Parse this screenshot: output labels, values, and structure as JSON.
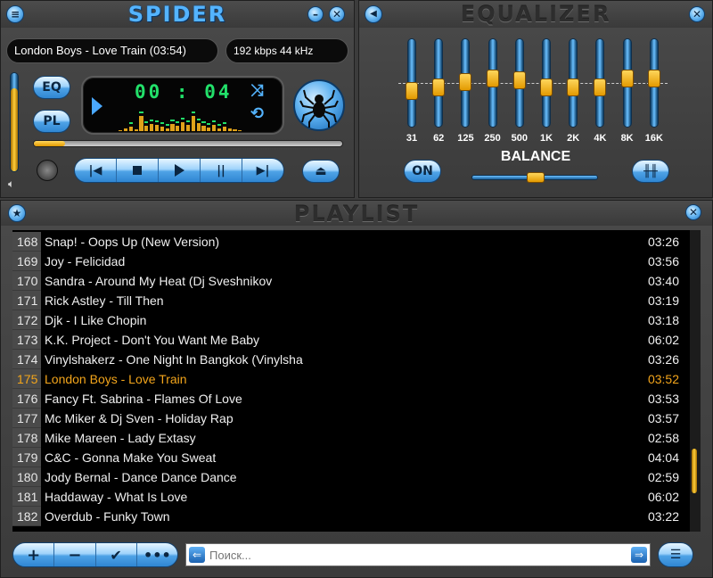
{
  "player": {
    "title": "SPIDER",
    "track_display": "London Boys - Love Train (03:54)",
    "bitrate_display": "192 kbps 44 kHz",
    "time": "00 : 04",
    "eq_button": "EQ",
    "pl_button": "PL",
    "seek_progress": 0.1,
    "volume_level": 0.85,
    "icons": {
      "menu": "menu-icon",
      "minimize": "minimize-icon",
      "close": "close-icon",
      "play_indicator": "play-indicator-icon",
      "shuffle": "shuffle-icon",
      "repeat": "repeat-icon",
      "spider_logo": "spider-logo-icon",
      "prev": "prev-icon",
      "stop": "stop-icon",
      "play": "play-icon",
      "pause": "pause-icon",
      "next": "next-icon",
      "eject": "eject-icon",
      "speaker": "speaker-icon"
    },
    "spectrum_levels": [
      0.05,
      0.1,
      0.18,
      0.08,
      0.6,
      0.22,
      0.3,
      0.25,
      0.18,
      0.12,
      0.28,
      0.2,
      0.35,
      0.25,
      0.62,
      0.32,
      0.22,
      0.15,
      0.25,
      0.12,
      0.18,
      0.1,
      0.08,
      0.05
    ]
  },
  "equalizer": {
    "title": "EQUALIZER",
    "bands": [
      {
        "label": "31",
        "level": 0.4
      },
      {
        "label": "62",
        "level": 0.45
      },
      {
        "label": "125",
        "level": 0.52
      },
      {
        "label": "250",
        "level": 0.58
      },
      {
        "label": "500",
        "level": 0.55
      },
      {
        "label": "1K",
        "level": 0.45
      },
      {
        "label": "2K",
        "level": 0.45
      },
      {
        "label": "4K",
        "level": 0.45
      },
      {
        "label": "8K",
        "level": 0.58
      },
      {
        "label": "16K",
        "level": 0.58
      }
    ],
    "on_button": "ON",
    "balance_label": "BALANCE",
    "balance_value": 0.5,
    "settings_icon": "sliders-icon",
    "speaker_icon": "speaker-icon"
  },
  "playlist": {
    "title": "PLAYLIST",
    "current_index": 7,
    "tracks": [
      {
        "num": "168",
        "title": "Snap! - Oops Up (New Version)",
        "duration": "03:26"
      },
      {
        "num": "169",
        "title": "Joy - Felicidad",
        "duration": "03:56"
      },
      {
        "num": "170",
        "title": "Sandra - Around My Heat (Dj Sveshnikov",
        "duration": "03:40"
      },
      {
        "num": "171",
        "title": "Rick Astley - Till Then",
        "duration": "03:19"
      },
      {
        "num": "172",
        "title": "Djk - I Like Chopin",
        "duration": "03:18"
      },
      {
        "num": "173",
        "title": "K.K. Project - Don't You Want Me Baby",
        "duration": "06:02"
      },
      {
        "num": "174",
        "title": "Vinylshakerz - One Night In Bangkok (Vinylsha",
        "duration": "03:26"
      },
      {
        "num": "175",
        "title": "London Boys - Love Train",
        "duration": "03:52"
      },
      {
        "num": "176",
        "title": "Fancy Ft. Sabrina - Flames Of Love",
        "duration": "03:53"
      },
      {
        "num": "177",
        "title": "Mc Miker & Dj Sven - Holiday Rap",
        "duration": "03:57"
      },
      {
        "num": "178",
        "title": "Mike Mareen - Lady Extasy",
        "duration": "02:58"
      },
      {
        "num": "179",
        "title": "C&C - Gonna Make You Sweat",
        "duration": "04:04"
      },
      {
        "num": "180",
        "title": "Jody Bernal - Dance Dance Dance",
        "duration": "02:59"
      },
      {
        "num": "181",
        "title": "Haddaway - What Is Love",
        "duration": "06:02"
      },
      {
        "num": "182",
        "title": "Overdub - Funky Town",
        "duration": "03:22"
      }
    ],
    "search_placeholder": "Поиск...",
    "scroll_position": 0.85,
    "toolbar_icons": [
      "plus-icon",
      "minus-icon",
      "check-icon",
      "more-icon"
    ]
  }
}
